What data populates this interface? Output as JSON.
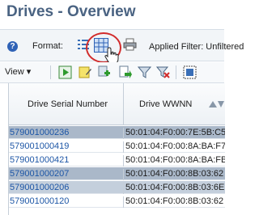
{
  "page": {
    "title": "Drives - Overview"
  },
  "format_bar": {
    "format_label": "Format:",
    "applied_filter_label": "Applied Filter: Unfiltered"
  },
  "toolbar": {
    "view_label": "View"
  },
  "table": {
    "columns": [
      "Drive Serial Number",
      "Drive WWNN"
    ],
    "rows": [
      {
        "serial": "579001000236",
        "wwnn": "50:01:04:F0:00:7E:5B:C5",
        "selected": true
      },
      {
        "serial": "579001000419",
        "wwnn": "50:01:04:F0:00:8A:BA:F7",
        "selected": false
      },
      {
        "serial": "579001000421",
        "wwnn": "50:01:04:F0:00:8A:BA:FB",
        "selected": false
      },
      {
        "serial": "579001000207",
        "wwnn": "50:01:04:F0:00:8B:03:62",
        "selected": true
      },
      {
        "serial": "579001000206",
        "wwnn": "50:01:04:F0:00:8B:03:6E",
        "selected": true
      },
      {
        "serial": "579001000120",
        "wwnn": "50:01:04:F0:00:8B:03:62",
        "selected": false
      }
    ]
  },
  "colors": {
    "title": "#4a6382",
    "link": "#1d56a6",
    "selected_row": "#aab8c9",
    "highlight_ring": "#d22b2b"
  }
}
